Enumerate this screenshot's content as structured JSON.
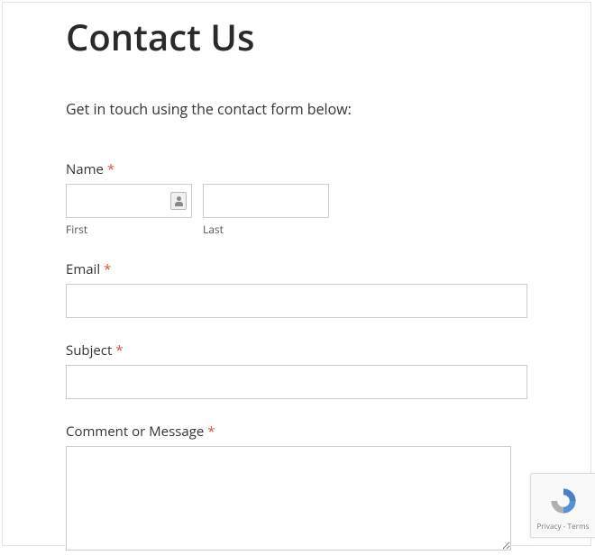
{
  "title": "Contact Us",
  "intro": "Get in touch using the contact form below:",
  "form": {
    "name": {
      "label": "Name",
      "required": "*",
      "first": {
        "sublabel": "First",
        "value": ""
      },
      "last": {
        "sublabel": "Last",
        "value": ""
      }
    },
    "email": {
      "label": "Email",
      "required": "*",
      "value": ""
    },
    "subject": {
      "label": "Subject",
      "required": "*",
      "value": ""
    },
    "message": {
      "label": "Comment or Message",
      "required": "*",
      "value": ""
    }
  },
  "recaptcha": {
    "text": "Privacy - Terms"
  }
}
